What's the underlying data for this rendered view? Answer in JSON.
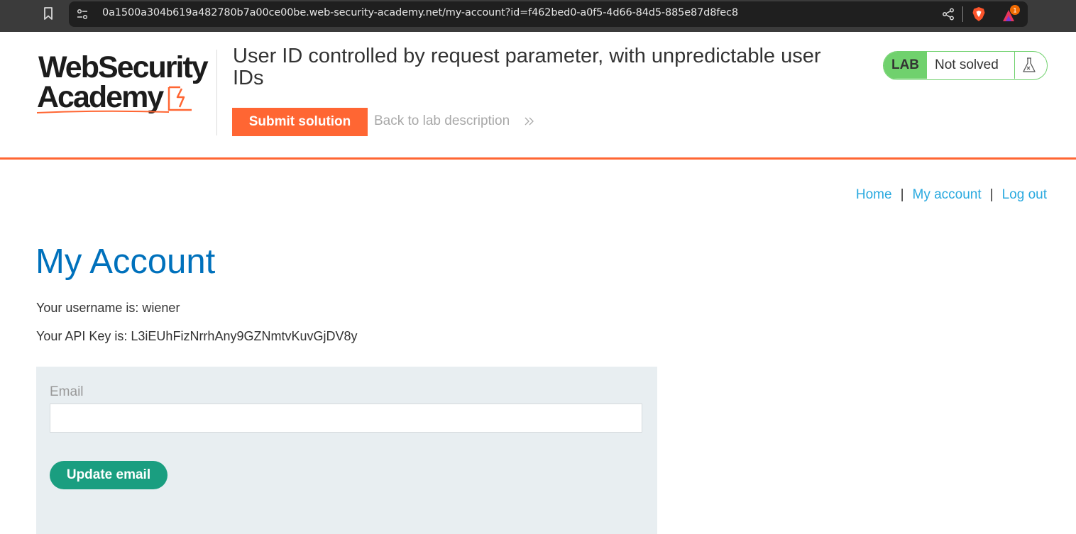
{
  "browser": {
    "url": "0a1500a304b619a482780b7a00ce00be.web-security-academy.net/my-account?id=f462bed0-a0f5-4d66-84d5-885e87d8fec8",
    "rewards_count": "1"
  },
  "header": {
    "logo_line1": "WebSecurity",
    "logo_line2": "Academy",
    "lab_title": "User ID controlled by request parameter, with unpredictable user IDs",
    "submit_label": "Submit solution",
    "back_label": "Back to lab description",
    "badge_lab": "LAB",
    "badge_status": "Not solved"
  },
  "nav": {
    "home": "Home",
    "my_account": "My account",
    "log_out": "Log out",
    "separator": "|"
  },
  "main": {
    "title": "My Account",
    "username_line": "Your username is: wiener",
    "apikey_line": "Your API Key is: L3iEUhFizNrrhAny9GZNmtvKuvGjDV8y",
    "email_label": "Email",
    "email_value": "",
    "update_label": "Update email"
  },
  "colors": {
    "brand_orange": "#ff6633",
    "link_blue": "#29a9df",
    "title_blue": "#0071bc",
    "lab_green": "#70d16d",
    "button_teal": "#1a9e80"
  }
}
